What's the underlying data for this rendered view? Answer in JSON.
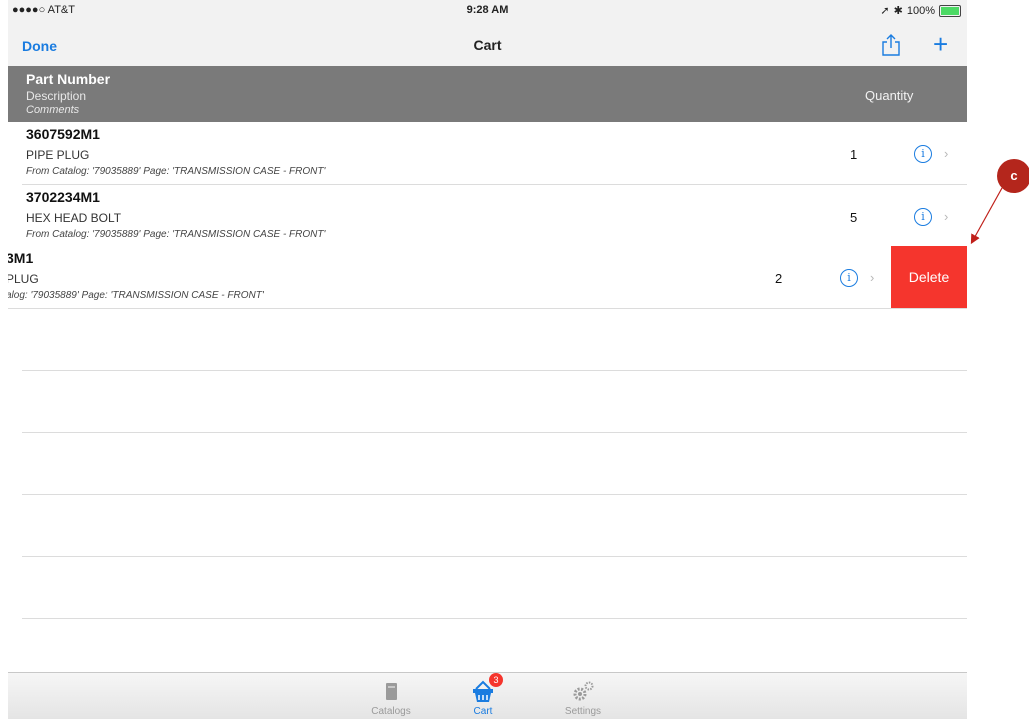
{
  "status_bar": {
    "carrier": "●●●●○ AT&T",
    "time": "9:28 AM",
    "battery": "100%"
  },
  "nav": {
    "left_button": "Done",
    "title": "Cart"
  },
  "table_header": {
    "part_number": "Part Number",
    "description": "Description",
    "comments": "Comments",
    "quantity": "Quantity"
  },
  "rows": [
    {
      "part_number": "3607592M1",
      "description": "PIPE PLUG",
      "comment": "From Catalog: '79035889' Page: 'TRANSMISSION CASE - FRONT'",
      "quantity": "1"
    },
    {
      "part_number": "3702234M1",
      "description": "HEX HEAD BOLT",
      "comment": "From Catalog: '79035889' Page: 'TRANSMISSION CASE - FRONT'",
      "quantity": "5"
    },
    {
      "part_number": "3M1",
      "description": "PLUG",
      "comment": "alog: '79035889' Page: 'TRANSMISSION CASE - FRONT'",
      "quantity": "2"
    }
  ],
  "swipe_action": {
    "label": "Delete",
    "color": "#f5352d"
  },
  "tab_bar": {
    "tabs": [
      {
        "label": "Catalogs",
        "icon": "book-icon"
      },
      {
        "label": "Cart",
        "icon": "basket-icon",
        "badge": "3",
        "active": true
      },
      {
        "label": "Settings",
        "icon": "gears-icon"
      }
    ]
  },
  "annotation": {
    "label": "c"
  },
  "colors": {
    "accent": "#1a7ce0",
    "header_bg": "#7a7a7a",
    "delete": "#f5352d",
    "callout": "#b4261c"
  }
}
